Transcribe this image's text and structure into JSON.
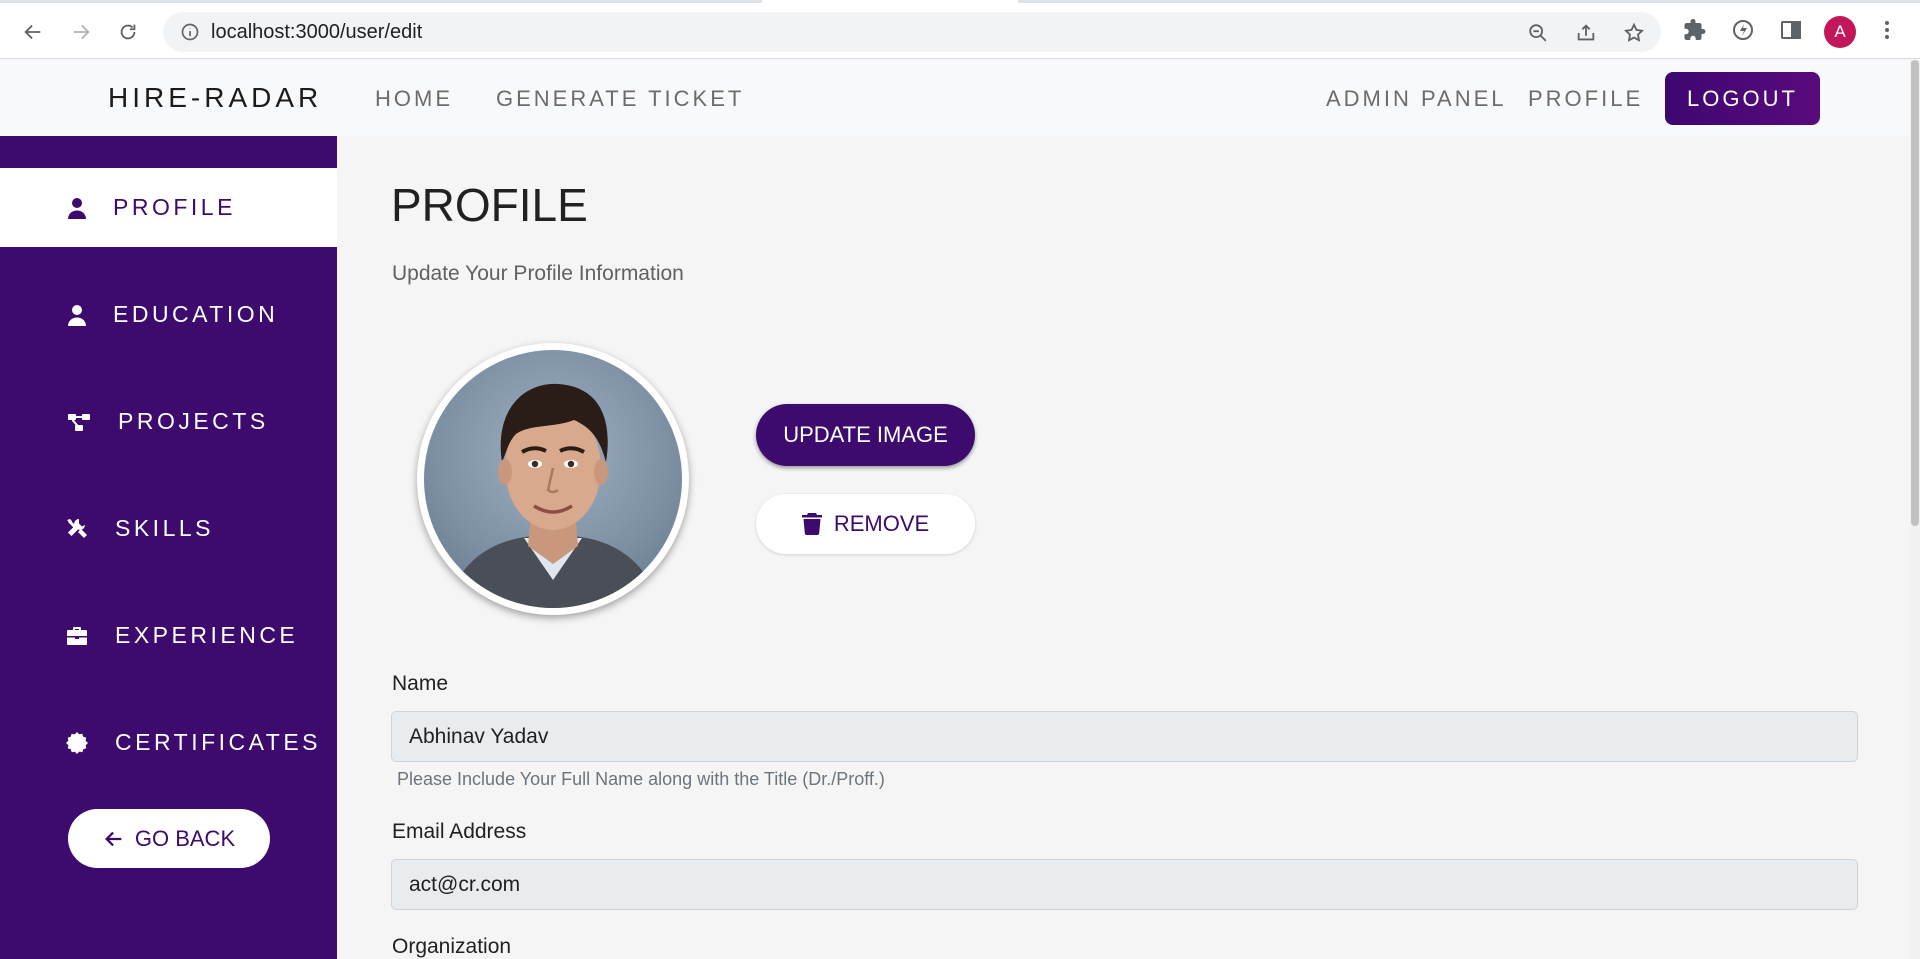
{
  "browser": {
    "url": "localhost:3000/user/edit",
    "profile_initial": "A",
    "profile_color": "#c2185b"
  },
  "navbar": {
    "brand": "HIRE-RADAR",
    "links": {
      "home": "HOME",
      "generate_ticket": "GENERATE TICKET",
      "admin_panel": "ADMIN PANEL",
      "profile": "PROFILE"
    },
    "logout_label": "LOGOUT"
  },
  "sidebar": {
    "items": [
      {
        "label": "PROFILE",
        "icon": "user-icon",
        "active": true
      },
      {
        "label": "EDUCATION",
        "icon": "user-icon",
        "active": false
      },
      {
        "label": "PROJECTS",
        "icon": "project-diagram-icon",
        "active": false
      },
      {
        "label": "SKILLS",
        "icon": "tools-icon",
        "active": false
      },
      {
        "label": "EXPERIENCE",
        "icon": "briefcase-icon",
        "active": false
      },
      {
        "label": "CERTIFICATES",
        "icon": "certificate-badge-icon",
        "active": false
      }
    ],
    "go_back_label": "GO BACK"
  },
  "main": {
    "title": "PROFILE",
    "subtitle": "Update Your Profile Information",
    "update_image_label": "UPDATE IMAGE",
    "remove_label": "REMOVE",
    "fields": {
      "name": {
        "label": "Name",
        "value": "Abhinav Yadav",
        "help": "Please Include Your Full Name along with the Title (Dr./Proff.)"
      },
      "email": {
        "label": "Email Address",
        "value": "act@cr.com"
      },
      "organization": {
        "label": "Organization"
      }
    }
  },
  "colors": {
    "primary": "#3d0a6e",
    "sidebar_bg": "#3d0a6e",
    "page_bg": "#f5f5f5",
    "input_bg": "#e9ecef"
  }
}
